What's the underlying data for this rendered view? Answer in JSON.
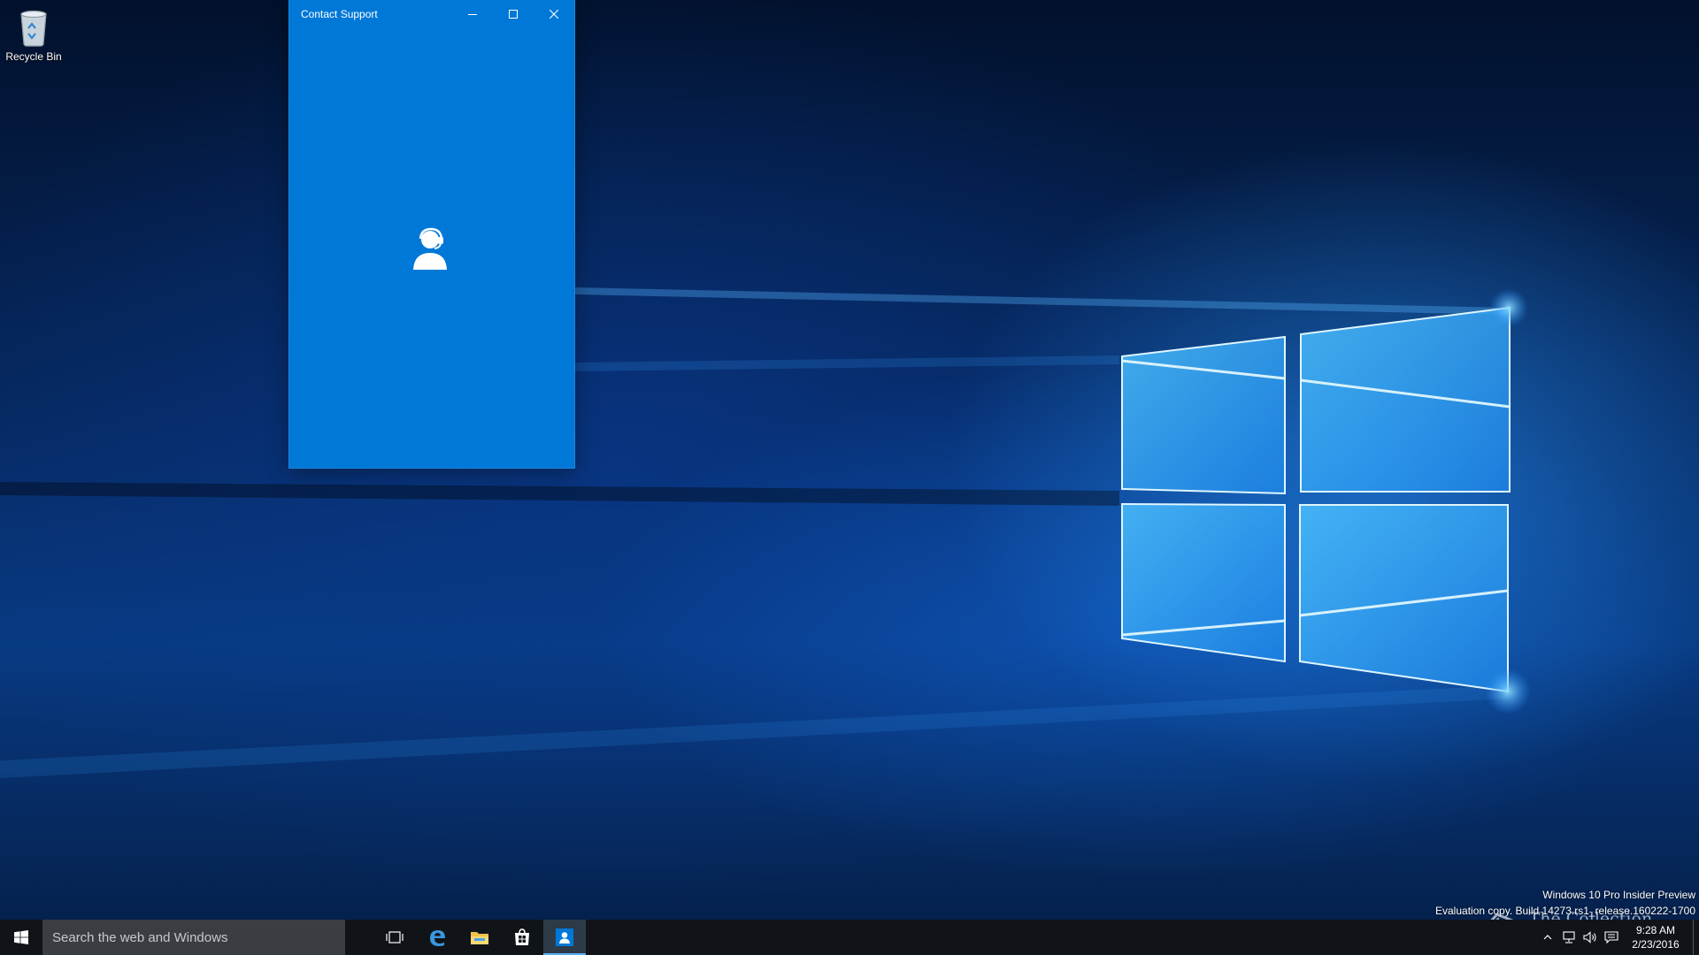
{
  "desktop": {
    "icons": [
      {
        "label": "Recycle Bin",
        "icon": "recycle-bin-icon"
      }
    ]
  },
  "window": {
    "title": "Contact Support",
    "controls": [
      "minimize-icon",
      "maximize-icon",
      "close-icon"
    ],
    "splash_icon": "support-agent-icon",
    "accent_color": "#0078d7"
  },
  "watermark": {
    "line1": "Windows 10 Pro Insider Preview",
    "line2": "Evaluation copy. Build 14273.rs1_release.160222-1700",
    "site_logo_text": "The Collection Book"
  },
  "taskbar": {
    "search_placeholder": "Search the web and Windows",
    "pinned": [
      "task-view-icon",
      "edge-icon",
      "file-explorer-icon",
      "store-icon",
      "contact-support-icon"
    ],
    "tray": {
      "time": "9:28 AM",
      "date": "2/23/2016",
      "icons": [
        "chevron-up-icon",
        "network-icon",
        "volume-icon",
        "action-center-icon"
      ]
    }
  }
}
